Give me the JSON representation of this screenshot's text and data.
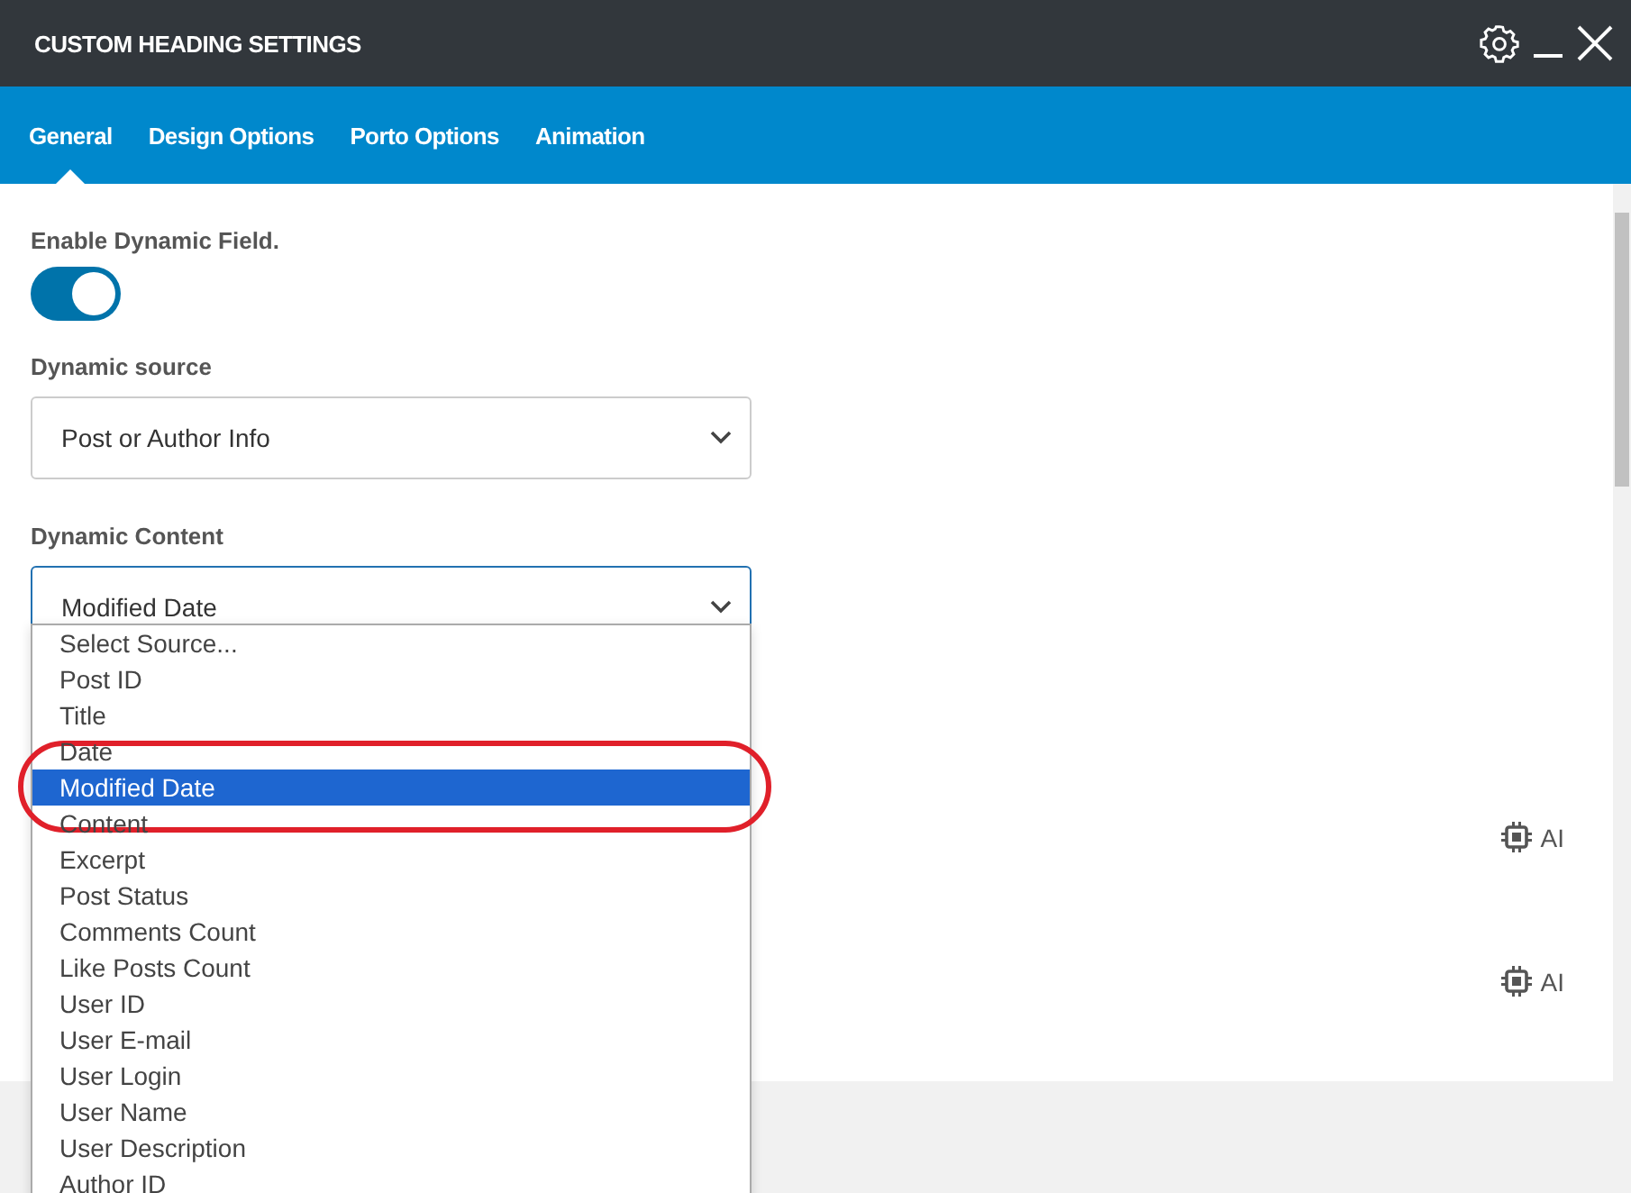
{
  "window": {
    "title": "CUSTOM HEADING SETTINGS"
  },
  "tabs": [
    {
      "label": "General",
      "selected": true
    },
    {
      "label": "Design Options",
      "selected": false
    },
    {
      "label": "Porto Options",
      "selected": false
    },
    {
      "label": "Animation",
      "selected": false
    }
  ],
  "dynamic_field": {
    "label": "Enable Dynamic Field.",
    "on": true
  },
  "dynamic_source": {
    "label": "Dynamic source",
    "value": "Post or Author Info"
  },
  "dynamic_content": {
    "label": "Dynamic Content",
    "value": "Modified Date",
    "expanded": true,
    "options": [
      {
        "label": "Select Source...",
        "selected": false
      },
      {
        "label": "Post ID",
        "selected": false
      },
      {
        "label": "Title",
        "selected": false
      },
      {
        "label": "Date",
        "selected": false
      },
      {
        "label": "Modified Date",
        "selected": true
      },
      {
        "label": "Content",
        "selected": false
      },
      {
        "label": "Excerpt",
        "selected": false
      },
      {
        "label": "Post Status",
        "selected": false
      },
      {
        "label": "Comments Count",
        "selected": false
      },
      {
        "label": "Like Posts Count",
        "selected": false
      },
      {
        "label": "User ID",
        "selected": false
      },
      {
        "label": "User E-mail",
        "selected": false
      },
      {
        "label": "User Login",
        "selected": false
      },
      {
        "label": "User Name",
        "selected": false
      },
      {
        "label": "User Description",
        "selected": false
      },
      {
        "label": "Author ID",
        "selected": false
      }
    ]
  },
  "ai_buttons": [
    "AI",
    "AI"
  ]
}
